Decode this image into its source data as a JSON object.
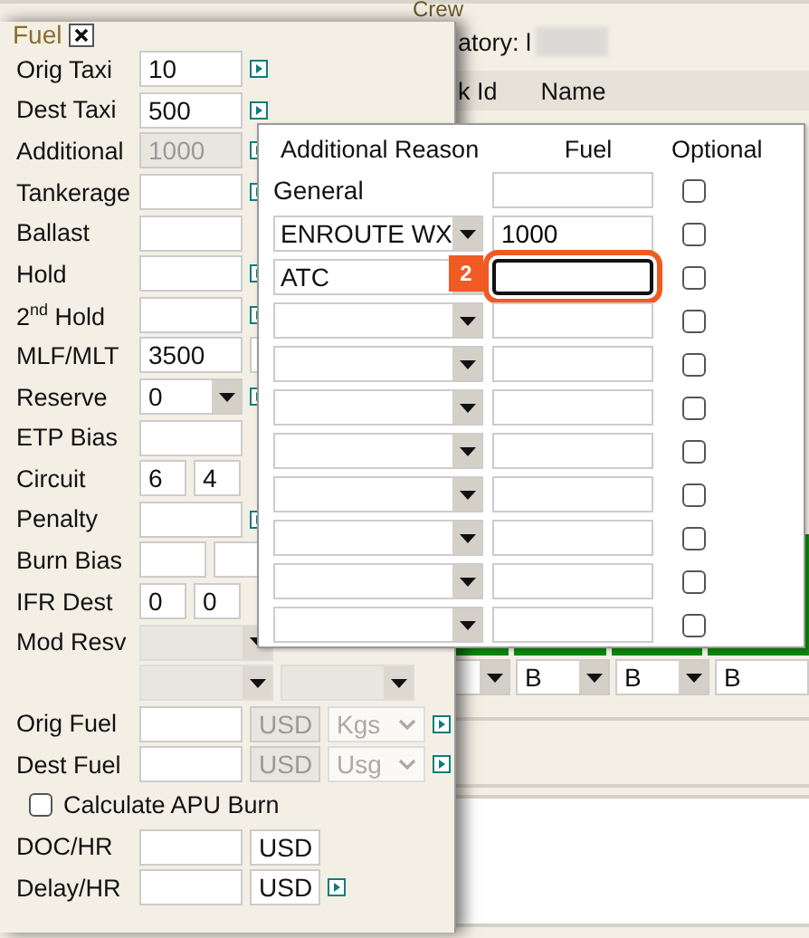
{
  "background": {
    "crew_legend": "Crew",
    "field_label": "atory: l",
    "table_header": [
      "k Id",
      "Name"
    ],
    "grade_selects": [
      {
        "kind": "select"
      },
      {
        "kind": "select",
        "value": "B"
      },
      {
        "kind": "select",
        "value": "B"
      },
      {
        "kind": "field",
        "value": "B"
      }
    ]
  },
  "fuel_panel": {
    "title": "Fuel",
    "rows": [
      {
        "kind": "input",
        "label": "Orig Taxi",
        "fields": [
          {
            "value": "10",
            "disabled": false
          }
        ],
        "link": true
      },
      {
        "kind": "input",
        "label": "Dest Taxi",
        "fields": [
          {
            "value": "500",
            "disabled": false
          }
        ],
        "link": true
      },
      {
        "kind": "input",
        "label": "Additional",
        "fields": [
          {
            "value": "1000",
            "disabled": true
          }
        ],
        "link": true
      },
      {
        "kind": "input",
        "label": "Tankerage",
        "fields": [
          {
            "disabled": false
          }
        ],
        "link": true
      },
      {
        "kind": "input",
        "label": "Ballast",
        "fields": [
          {
            "disabled": false
          }
        ],
        "link": false
      },
      {
        "kind": "input",
        "label": "Hold",
        "fields": [
          {
            "disabled": false
          }
        ],
        "link": true
      },
      {
        "kind": "input",
        "label": "2$^{nd}$ Hold",
        "fields": [
          {
            "disabled": false
          }
        ],
        "link": true
      },
      {
        "kind": "input",
        "label": "MLF/MLT",
        "fields": [
          {
            "value": "3500",
            "disabled": false
          },
          {
            "disabled": false
          }
        ],
        "link": false
      },
      {
        "kind": "select",
        "label": "Reserve",
        "fields": [
          {
            "value": "0",
            "disabled": false
          }
        ],
        "link": true
      },
      {
        "kind": "input",
        "label": "ETP Bias",
        "fields": [
          {
            "disabled": false
          }
        ],
        "link": false
      },
      {
        "kind": "pair",
        "label": "Circuit",
        "fields": [
          {
            "value": "6",
            "disabled": false
          },
          {
            "value": "4",
            "disabled": false
          }
        ],
        "link": false
      },
      {
        "kind": "input",
        "label": "Penalty",
        "fields": [
          {
            "disabled": false
          }
        ],
        "link": true
      },
      {
        "kind": "split",
        "label": "Burn Bias",
        "fields": [
          {
            "disabled": false
          },
          {
            "disabled": false
          }
        ],
        "link": false
      },
      {
        "kind": "pair",
        "label": "IFR Dest",
        "fields": [
          {
            "value": "0",
            "disabled": false
          },
          {
            "value": "0",
            "disabled": false
          }
        ],
        "link": false
      },
      {
        "kind": "select",
        "label": "Mod Resv",
        "fields": [
          {
            "disabled": true
          }
        ],
        "link": false
      },
      {
        "kind": "selects",
        "fields": [
          {
            "disabled": true
          },
          {
            "disabled": true
          }
        ],
        "link": false
      },
      {
        "kind": "currency",
        "label": "Orig Fuel",
        "fields": [
          {
            "disabled": false
          },
          {
            "value": "USD",
            "disabled": true
          },
          {
            "value": "Kgs",
            "disabled": true
          }
        ],
        "link": true
      },
      {
        "kind": "currency",
        "label": "Dest Fuel",
        "fields": [
          {
            "disabled": false
          },
          {
            "value": "USD",
            "disabled": true
          },
          {
            "value": "Usg",
            "disabled": true
          }
        ],
        "link": true
      },
      {
        "kind": "checkbox",
        "label": "Calculate APU Burn",
        "checked": false
      },
      {
        "kind": "cost",
        "label": "DOC/HR",
        "fields": [
          {
            "disabled": false
          },
          {
            "value": "USD",
            "disabled": false
          }
        ],
        "link": false
      },
      {
        "kind": "cost",
        "label": "Delay/HR",
        "fields": [
          {
            "disabled": false
          },
          {
            "value": "USD",
            "disabled": false
          }
        ],
        "link": true
      }
    ]
  },
  "popup": {
    "headers": [
      "Additional Reason",
      "Fuel",
      "Optional"
    ],
    "rows": [
      {
        "kind": "label",
        "reason": "General",
        "optional": false,
        "focused": false
      },
      {
        "kind": "select",
        "reason": "ENROUTE WX",
        "fuel": "1000",
        "optional": false,
        "focused": false
      },
      {
        "kind": "select",
        "reason": "ATC",
        "optional": false,
        "focused": true
      },
      {
        "kind": "select",
        "optional": false,
        "focused": false
      },
      {
        "kind": "select",
        "optional": false,
        "focused": false
      },
      {
        "kind": "select",
        "optional": false,
        "focused": false
      },
      {
        "kind": "select",
        "optional": false,
        "focused": false
      },
      {
        "kind": "select",
        "optional": false,
        "focused": false
      },
      {
        "kind": "select",
        "optional": false,
        "focused": false
      },
      {
        "kind": "select",
        "optional": false,
        "focused": false
      },
      {
        "kind": "select",
        "optional": false,
        "focused": false
      }
    ]
  },
  "annotation": {
    "badge": "2"
  }
}
